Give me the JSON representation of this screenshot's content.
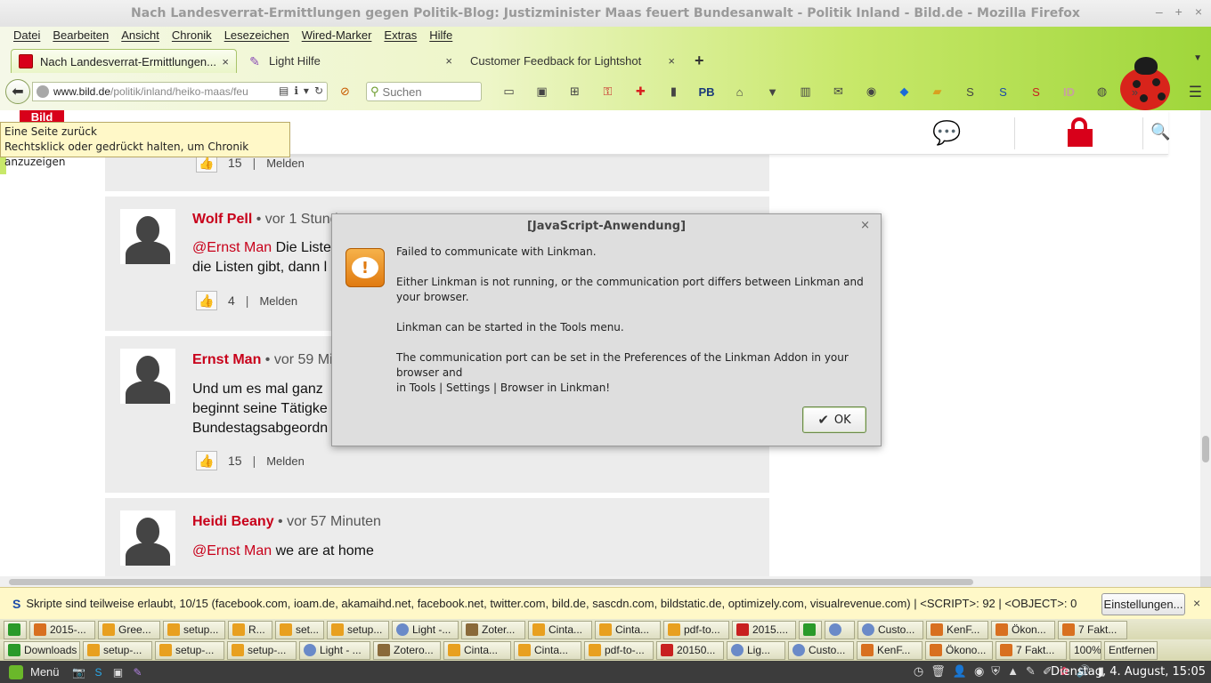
{
  "window": {
    "title": "Nach Landesverrat-Ermittlungen gegen Politik-Blog: Justizminister Maas feuert Bundesanwalt - Politik Inland - Bild.de - Mozilla Firefox",
    "controls": [
      "–",
      "+",
      "×"
    ]
  },
  "menubar": [
    "Datei",
    "Bearbeiten",
    "Ansicht",
    "Chronik",
    "Lesezeichen",
    "Wired-Marker",
    "Extras",
    "Hilfe"
  ],
  "tabs": [
    {
      "label": "Nach Landesverrat-Ermittlungen...",
      "close": "×"
    },
    {
      "label": "Light Hilfe",
      "close": "×"
    },
    {
      "label": "Customer Feedback for Lightshot",
      "close": "×"
    }
  ],
  "newtab": "+",
  "navbar": {
    "url_host": "www.bild.de",
    "url_path": "/politik/inland/heiko-maas/feu",
    "search_placeholder": "Suchen",
    "pb_label": "PB",
    "id_label": "ID"
  },
  "tooltip": {
    "line1": "Eine Seite zurück",
    "line2": "Rechtsklick oder gedrückt halten, um Chronik anzuzeigen"
  },
  "site": {
    "logo": "Bild"
  },
  "comments": [
    {
      "likes": "15",
      "sep": "|",
      "report": "Melden"
    },
    {
      "author": "Wolf Pell",
      "time": "• vor 1 Stund",
      "mention": "@Ernst Man",
      "text": " Die Liste",
      "text2": "die Listen gibt, dann l",
      "likes": "4",
      "sep": "|",
      "report": "Melden"
    },
    {
      "author": "Ernst Man",
      "time": "• vor 59 Mi",
      "text": "Und um es mal ganz",
      "text2": "beginnt seine Tätigke",
      "text3": "Bundestagsabgeordn",
      "likes": "15",
      "sep": "|",
      "report": "Melden"
    },
    {
      "author": "Heidi Beany",
      "time": "• vor 57 Minuten",
      "mention": "@Ernst Man",
      "text": " we are at home"
    }
  ],
  "dialog": {
    "title": "[JavaScript-Anwendung]",
    "close": "×",
    "p1": "Failed to communicate with Linkman.",
    "p2": "Either Linkman is not running, or the communication port differs between Linkman and your browser.",
    "p3": "Linkman can be started in the Tools menu.",
    "p4": "The communication port can be set in the Preferences of the Linkman Addon in your browser and",
    "p4b": " in Tools | Settings | Browser in Linkman!",
    "ok": "OK"
  },
  "noscript": {
    "text": "Skripte sind teilweise erlaubt, 10/15 (facebook.com, ioam.de, akamaihd.net, facebook.net, twitter.com, bild.de, sascdn.com, bildstatic.de, optimizely.com, visualrevenue.com) | <SCRIPT>: 92 | <OBJECT>: 0",
    "button": "Einstellungen...",
    "close": "×"
  },
  "taskbar1": [
    "2015-...",
    "Gree...",
    "setup...",
    "R...",
    "set...",
    "setup...",
    "Light -...",
    "Zoter...",
    "Cinta...",
    "Cinta...",
    "pdf-to...",
    "2015....",
    "",
    "",
    "Custo...",
    "KenF...",
    "Ökon...",
    "7 Fakt..."
  ],
  "taskbar2": [
    "Downloads",
    "setup-...",
    "setup-...",
    "setup-...",
    "Light - ...",
    "Zotero...",
    "Cinta...",
    "Cinta...",
    "pdf-to-...",
    "20150...",
    "Lig...",
    "Custo...",
    "KenF...",
    "Ökono...",
    "7 Fakt...",
    "100%",
    "Entfernen"
  ],
  "panel": {
    "menu": "Menü",
    "clock": "Dienstag, 4. August, 15:05"
  }
}
